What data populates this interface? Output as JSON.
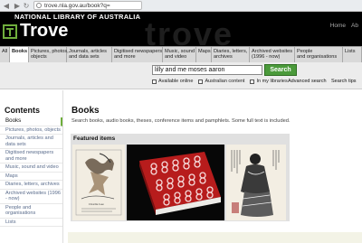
{
  "browser": {
    "url": "trove.nla.gov.au/book?q=",
    "back": "◀",
    "forward": "▶",
    "reload": "↻"
  },
  "header": {
    "institution": "NATIONAL LIBRARY OF AUSTRALIA",
    "brand": "Trove",
    "watermark": "trove",
    "links": [
      "Home",
      "Ab"
    ]
  },
  "tabs": [
    "All",
    "Books",
    "Pictures, photos,\nobjects",
    "Journals, articles\nand data sets",
    "Digitised newspapers\nand more",
    "Music, sound\nand video",
    "Maps",
    "Diaries, letters,\narchives",
    "Archived websites\n(1996 - now)",
    "People\nand organisations",
    "Lists"
  ],
  "search": {
    "query": "lilly and me moses aaron",
    "button": "Search",
    "options": [
      "Available online",
      "Australian content",
      "In my libraries"
    ],
    "advanced": "Advanced search",
    "tips": "Search tips"
  },
  "sidebar": {
    "title": "Contents",
    "items": [
      "Books",
      "Pictures, photos, objects",
      "Journals, articles and data sets",
      "Digitised newspapers and more",
      "Music, sound and video",
      "Maps",
      "Diaries, letters, archives",
      "Archived websites (1996 - now)",
      "People and organisations",
      "Lists"
    ]
  },
  "main": {
    "title": "Books",
    "description": "Search books, audio books, theses, conference items and pamphlets. Some full text is included.",
    "featured_label": "Featured items",
    "featured_caption": "Charlie Gee"
  },
  "colors": {
    "accent": "#6fae3c",
    "button": "#4b9a3b",
    "header_bg": "#000000"
  }
}
